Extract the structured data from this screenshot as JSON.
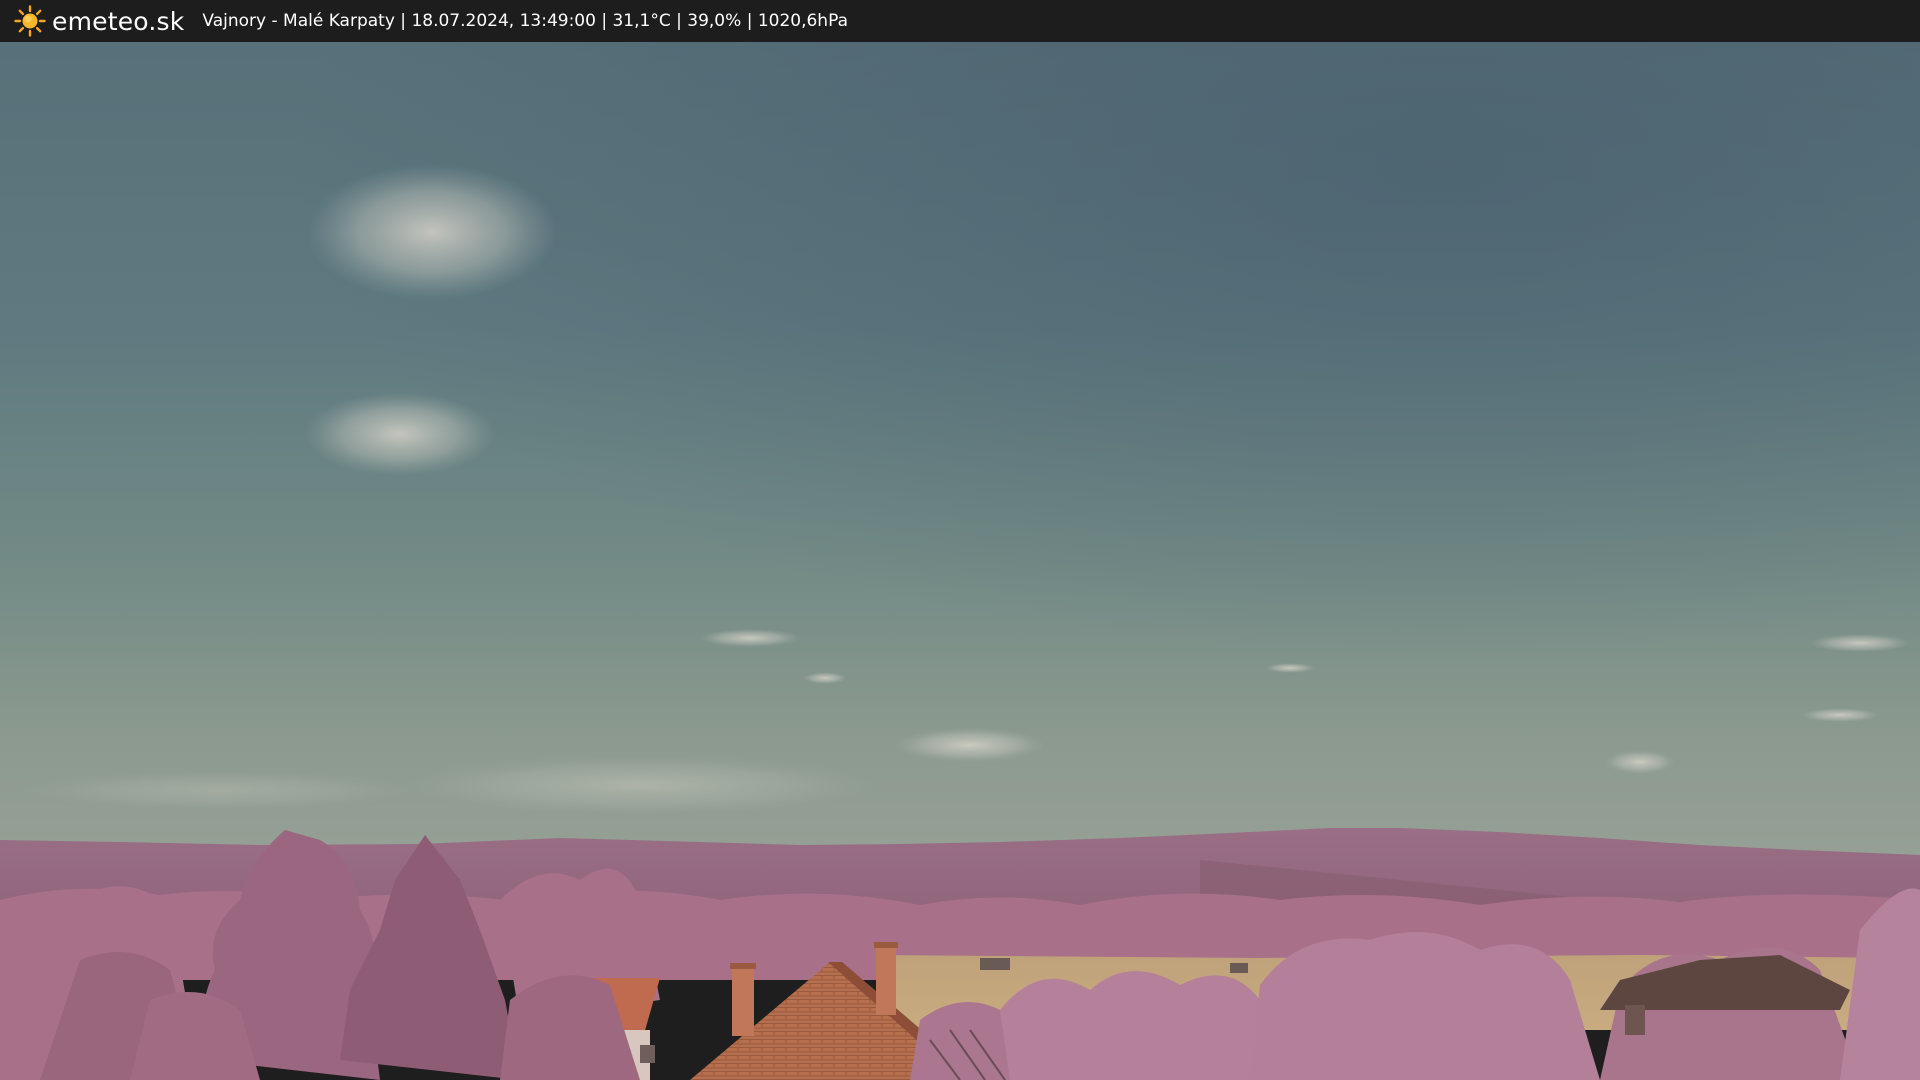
{
  "header": {
    "brand": "emeteo.sk",
    "location": "Vajnory - Malé Karpaty",
    "datetime": "18.07.2024, 13:49:00",
    "temperature": "31,1°C",
    "humidity": "39,0%",
    "pressure": "1020,6hPa",
    "separator": "|",
    "logo_icon": "sun-icon"
  },
  "colors": {
    "bar": "#1d1d1d",
    "sky_top": "#4f6772",
    "sky_horizon": "#8a9890",
    "hills": "#9c6f86",
    "foliage": "#b07a90",
    "roof": "#c06b4f",
    "field": "#c8a878"
  }
}
